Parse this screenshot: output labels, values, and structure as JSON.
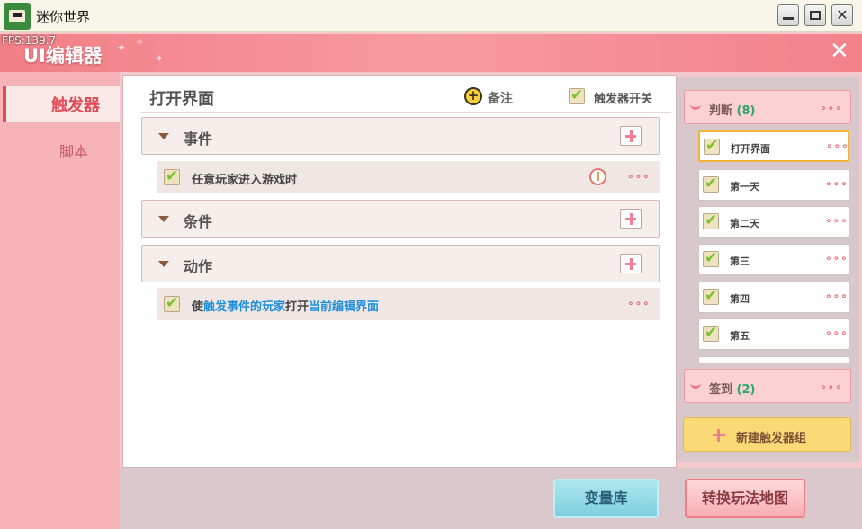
{
  "window": {
    "title": "迷你世界",
    "minimize_glyph": "—",
    "maximize_glyph": "□",
    "close_glyph": "✕"
  },
  "editor": {
    "fps": "FPS:139.7",
    "title": "UI编辑器",
    "close_glyph": "✕"
  },
  "sidebar": {
    "tabs": [
      {
        "label": "触发器",
        "active": true
      },
      {
        "label": "脚本",
        "active": false
      }
    ]
  },
  "main": {
    "title": "打开界面",
    "note_label": "备注",
    "note_icon_glyph": "+",
    "trigger_switch_label": "触发器开关",
    "trigger_switch_checked": true,
    "sections": [
      {
        "label": "事件",
        "rows": [
          {
            "parts": [
              {
                "text": "任意玩家进入游戏时",
                "highlight": false
              }
            ],
            "checked": true,
            "warning": true
          }
        ]
      },
      {
        "label": "条件",
        "rows": []
      },
      {
        "label": "动作",
        "rows": [
          {
            "parts": [
              {
                "text": "使",
                "highlight": false
              },
              {
                "text": "触发事件的玩家",
                "highlight": true
              },
              {
                "text": "打开",
                "highlight": false
              },
              {
                "text": "当前编辑界面",
                "highlight": true
              }
            ],
            "checked": true,
            "warning": false
          }
        ]
      }
    ],
    "more_glyph": "∘∘∘"
  },
  "right_panel": {
    "groups": [
      {
        "name": "判断",
        "count": "(8)",
        "items": [
          {
            "label": "打开界面",
            "checked": true,
            "active": true
          },
          {
            "label": "第一天",
            "checked": true,
            "active": false
          },
          {
            "label": "第二天",
            "checked": true,
            "active": false
          },
          {
            "label": "第三",
            "checked": true,
            "active": false
          },
          {
            "label": "第四",
            "checked": true,
            "active": false
          },
          {
            "label": "第五",
            "checked": true,
            "active": false
          }
        ]
      },
      {
        "name": "签到",
        "count": "(2)",
        "items": []
      }
    ],
    "new_group_label": "新建触发器组"
  },
  "bottom": {
    "variables_button": "变量库",
    "switch_button": "转换玩法地图"
  },
  "colors": {
    "accent": "#e24a56",
    "header": "#f27f87",
    "highlight_text": "#1e8fdb",
    "active_border": "#f2b437",
    "count_green": "#2ea66d"
  }
}
